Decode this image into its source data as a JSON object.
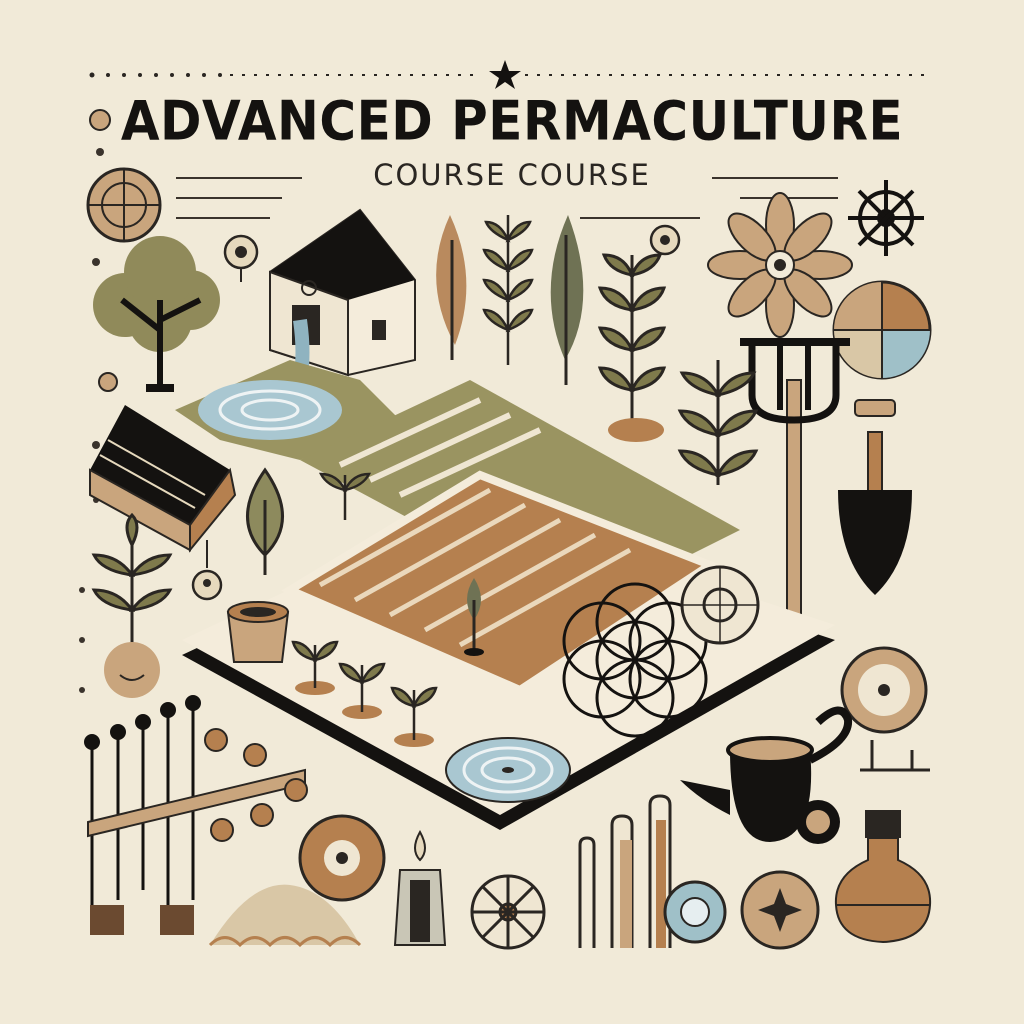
{
  "poster": {
    "title": "ADVANCED PERMACULTURE",
    "subtitle": "COURSE COURSE"
  },
  "colors": {
    "background": "#f1ead8",
    "ink": "#141210",
    "olive": "#7f7a4c",
    "soil": "#b5804f",
    "water": "#8fb3c0",
    "tan": "#c9a57d"
  },
  "icons": [
    "tree-icon",
    "barn-icon",
    "stream-icon",
    "leaf-icon",
    "fern-icon",
    "feather-leaf-icon",
    "sprout-icon",
    "flower-mandala-icon",
    "ship-wheel-icon",
    "pie-chart-icon",
    "pitchfork-icon",
    "trowel-icon",
    "book-icon",
    "garden-bed-icon",
    "seedling-icon",
    "pot-icon",
    "flower-of-life-icon",
    "spiral-pond-icon",
    "teapot-icon",
    "jar-icon",
    "trellis-icon",
    "compass-icon",
    "star-icon",
    "bottle-icon"
  ]
}
